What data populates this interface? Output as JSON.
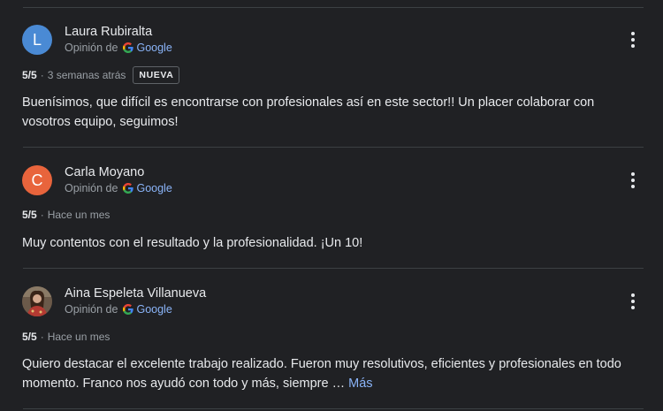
{
  "reviews": [
    {
      "author": "Laura Rubiralta",
      "avatar_letter": "L",
      "avatar_color": "#4a8ad4",
      "source_prefix": "Opinión de",
      "source_brand": "Google",
      "rating": "5/5",
      "separator": "·",
      "time": "3 semanas atrás",
      "badge": "NUEVA",
      "text": "Buenísimos, que difícil es encontrarse con profesionales así en este sector!! Un placer colaborar con vosotros equipo, seguimos!"
    },
    {
      "author": "Carla Moyano",
      "avatar_letter": "C",
      "avatar_color": "#e8643c",
      "source_prefix": "Opinión de",
      "source_brand": "Google",
      "rating": "5/5",
      "separator": "·",
      "time": "Hace un mes",
      "text": "Muy contentos con el resultado y la profesionalidad. ¡Un 10!"
    },
    {
      "author": "Aina Espeleta Villanueva",
      "avatar_icon": "profile-photo",
      "source_prefix": "Opinión de",
      "source_brand": "Google",
      "rating": "5/5",
      "separator": "·",
      "time": "Hace un mes",
      "text": "Quiero destacar el excelente trabajo realizado. Fueron muy resolutivos, eficientes y profesionales en todo momento. Franco nos ayudó con todo y más, siempre …",
      "more_link": "Más"
    }
  ],
  "colors": {
    "background": "#202124",
    "link": "#8ab4f8",
    "secondary_text": "#9aa0a6",
    "divider": "#3c4043"
  }
}
